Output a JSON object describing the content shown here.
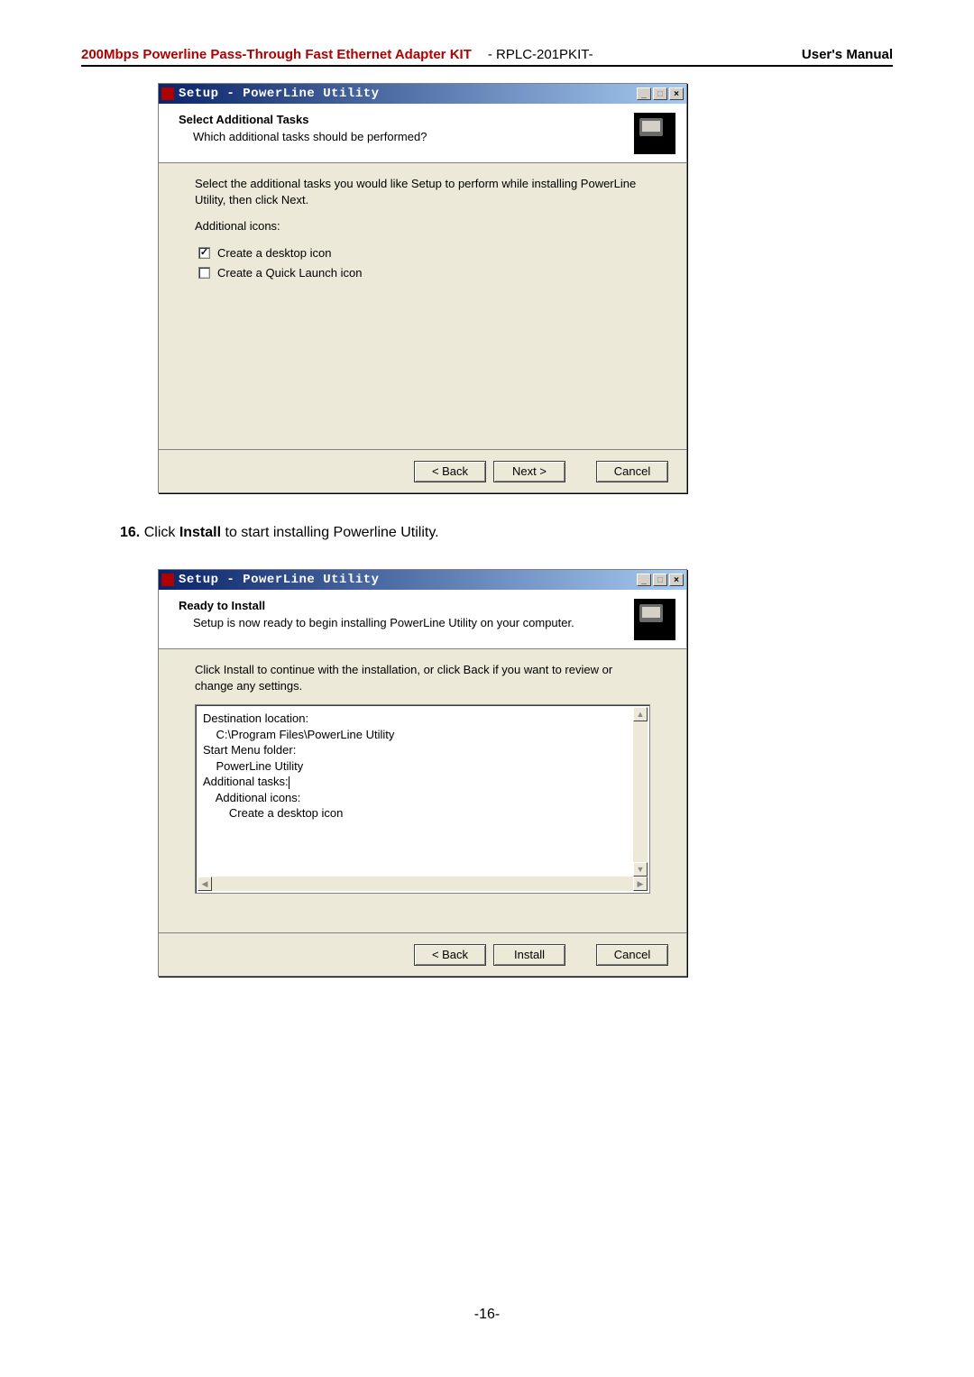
{
  "header": {
    "product": "200Mbps Powerline Pass-Through Fast Ethernet Adapter KIT",
    "model": "- RPLC-201PKIT-",
    "doc": "User's Manual"
  },
  "dialog1": {
    "title": "Setup - PowerLine Utility",
    "heading": "Select Additional Tasks",
    "desc": "Which additional tasks should be performed?",
    "body_text": "Select the additional tasks you would like Setup to perform while installing PowerLine Utility, then click Next.",
    "section_label": "Additional icons:",
    "chk1_label": "Create a desktop icon",
    "chk1_checked": "✓",
    "chk2_label": "Create a Quick Launch icon",
    "btn_back": "< Back",
    "btn_next": "Next >",
    "btn_cancel": "Cancel"
  },
  "instruction": {
    "num": "16.",
    "pre": "Click ",
    "bold": "Install",
    "post": " to start installing Powerline Utility."
  },
  "dialog2": {
    "title": "Setup - PowerLine Utility",
    "heading": "Ready to Install",
    "desc": "Setup is now ready to begin installing PowerLine Utility on your computer.",
    "body_text": "Click Install to continue with the installation, or click Back if you want to review or change any settings.",
    "summary": {
      "l1": "Destination location:",
      "l2": "    C:\\Program Files\\PowerLine Utility",
      "l3": "",
      "l4": "Start Menu folder:",
      "l5": "    PowerLine Utility",
      "l6": "",
      "l7": "Additional tasks:",
      "l8": "    Additional icons:",
      "l9": "        Create a desktop icon"
    },
    "btn_back": "< Back",
    "btn_install": "Install",
    "btn_cancel": "Cancel"
  },
  "page_num": "-16-"
}
